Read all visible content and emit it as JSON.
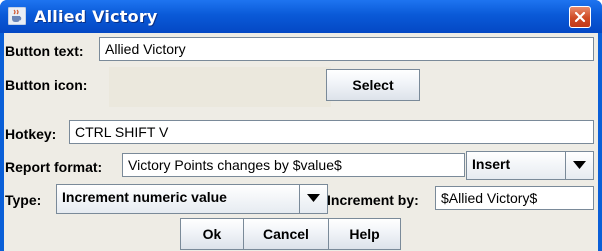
{
  "window": {
    "title": "Allied Victory",
    "icon": "java-cup-icon",
    "close_icon": "close-icon"
  },
  "form": {
    "button_text_label": "Button text:",
    "button_text_value": "Allied Victory",
    "button_icon_label": "Button icon:",
    "select_label": "Select",
    "hotkey_label": "Hotkey:",
    "hotkey_value": "CTRL SHIFT V",
    "report_format_label": "Report format:",
    "report_format_value": "Victory Points changes by $value$",
    "insert_label": "Insert",
    "type_label": "Type:",
    "type_value": "Increment numeric value",
    "increment_label": "Increment by:",
    "increment_value": "$Allied Victory$"
  },
  "buttons": {
    "ok": "Ok",
    "cancel": "Cancel",
    "help": "Help"
  },
  "colors": {
    "titlebar": "#0a5ad8",
    "client_bg": "#eeece5",
    "close_button": "#cf4a24"
  }
}
